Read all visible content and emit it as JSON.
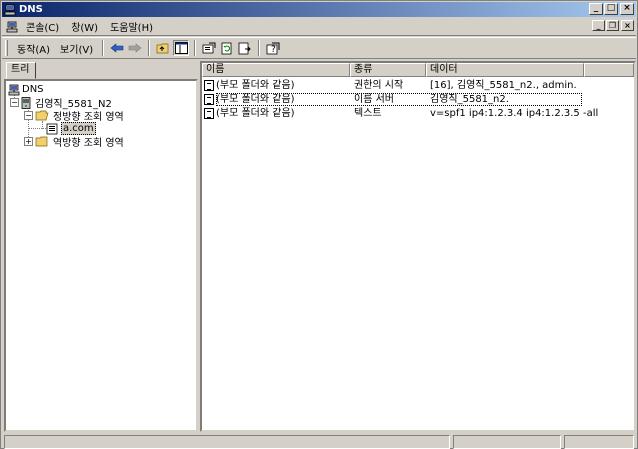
{
  "window": {
    "title": "DNS"
  },
  "menu": {
    "items": [
      {
        "label": "콘솔(C)"
      },
      {
        "label": "창(W)"
      },
      {
        "label": "도움말(H)"
      }
    ]
  },
  "toolbar": {
    "action_label": "동작(A)",
    "view_label": "보기(V)"
  },
  "left_pane": {
    "tab_label": "트리",
    "tree": {
      "root": "DNS",
      "server": "김영직_5581_N2",
      "forward_zone": "정방향 조회 영역",
      "zone": "a.com",
      "reverse_zone": "역방향 조회 영역"
    }
  },
  "right_pane": {
    "columns": [
      "이름",
      "종류",
      "데이터"
    ],
    "rows": [
      {
        "name": "(부모 폴더와 같음)",
        "type": "권한의 시작",
        "data": "[16], 김영직_5581_n2., admin."
      },
      {
        "name": "(부모 폴더와 같음)",
        "type": "이름 서버",
        "data": "김영직_5581_n2."
      },
      {
        "name": "(부모 폴더와 같음)",
        "type": "텍스트",
        "data": "v=spf1 ip4:1.2.3.4 ip4:1.2.3.5 -all"
      }
    ]
  },
  "colors": {
    "title_gradient_start": "#0a246a",
    "title_gradient_end": "#a6caf0",
    "face": "#d4d0c8"
  }
}
